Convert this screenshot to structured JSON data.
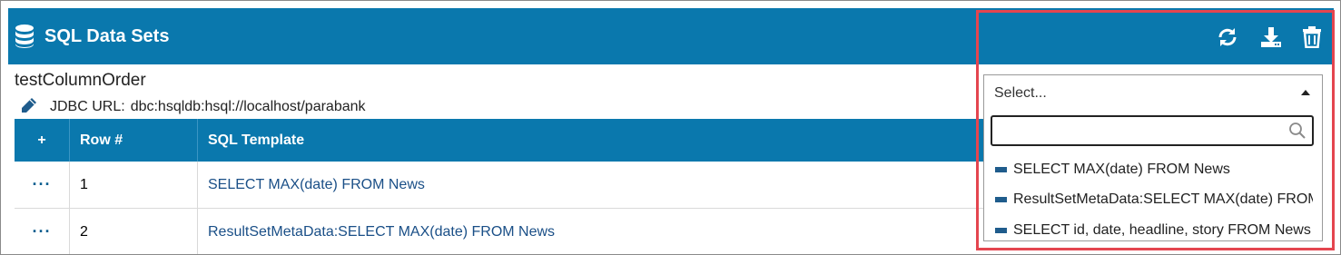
{
  "header": {
    "title": "SQL Data Sets",
    "icons": [
      "database-icon",
      "refresh-icon",
      "download-icon",
      "trash-icon"
    ],
    "color": "#0a78ad"
  },
  "dataset": {
    "name": "testColumnOrder",
    "jdbc_label": "JDBC URL:",
    "jdbc_value": "dbc:hsqldb:hsql://localhost/parabank"
  },
  "table": {
    "add_label": "+",
    "columns": [
      "Row #",
      "SQL Template"
    ],
    "rows": [
      {
        "menu": "···",
        "row": "1",
        "sql": "SELECT MAX(date) FROM News"
      },
      {
        "menu": "···",
        "row": "2",
        "sql": "ResultSetMetaData:SELECT MAX(date) FROM News"
      }
    ]
  },
  "dropdown": {
    "selected": "Select...",
    "search_value": "",
    "options": [
      "SELECT MAX(date) FROM News",
      "ResultSetMetaData:SELECT MAX(date) FROM News",
      "SELECT id, date, headline, story FROM News"
    ]
  },
  "highlight_color": "#e4454f"
}
